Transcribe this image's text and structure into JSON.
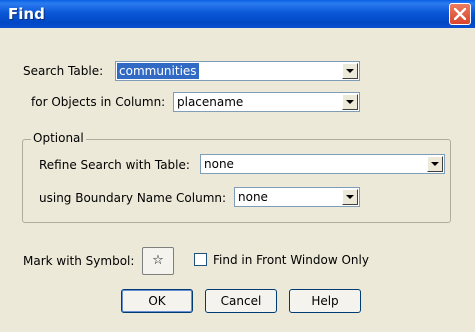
{
  "window": {
    "title": "Find"
  },
  "search_table": {
    "label": "Search Table:",
    "value": "communities"
  },
  "objects_column": {
    "label": "for Objects in Column:",
    "value": "placename"
  },
  "optional": {
    "legend": "Optional",
    "refine_table": {
      "label": "Refine Search with Table:",
      "value": "none"
    },
    "boundary_column": {
      "label": "using Boundary Name Column:",
      "value": "none"
    }
  },
  "symbol": {
    "label": "Mark with Symbol:",
    "glyph": "☆",
    "icon": "star-outline-icon"
  },
  "front_window_only": {
    "label": "Find in Front Window Only",
    "checked": false
  },
  "buttons": {
    "ok": "OK",
    "cancel": "Cancel",
    "help": "Help"
  },
  "colors": {
    "titlebar": "#0a58d8",
    "selection": "#316ac5",
    "dialog_bg": "#ece9d8"
  }
}
